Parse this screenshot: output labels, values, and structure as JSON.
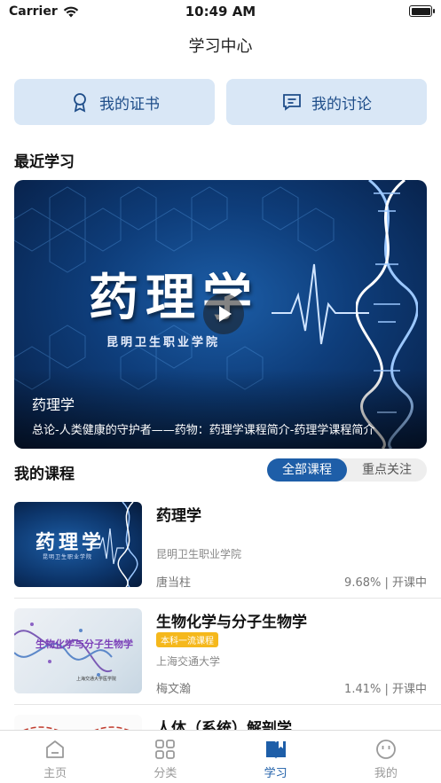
{
  "status": {
    "carrier": "Carrier",
    "time": "10:49 AM"
  },
  "nav": {
    "title": "学习中心"
  },
  "actions": {
    "certificate": "我的证书",
    "discussion": "我的讨论"
  },
  "recent": {
    "section_title": "最近学习",
    "banner_title_art": "药理学",
    "banner_school_art": "昆明卫生职业学院",
    "title": "药理学",
    "description": "总论-人类健康的守护者——药物：药理学课程简介-药理学课程简介"
  },
  "my_courses": {
    "section_title": "我的课程",
    "tabs": [
      "全部课程",
      "重点关注"
    ],
    "active_tab": 0,
    "items": [
      {
        "title": "药理学",
        "tag": "",
        "school": "昆明卫生职业学院",
        "teacher": "唐当柱",
        "progress": "9.68% | 开课中",
        "thumb_text": "药理学",
        "thumb_sub": "昆明卫生职业学院"
      },
      {
        "title": "生物化学与分子生物学",
        "tag": "本科一流课程",
        "school": "上海交通大学",
        "teacher": "梅文瀚",
        "progress": "1.41% | 开课中",
        "thumb_text": "生物化学与分子生物学",
        "thumb_sub": "上海交通大学医学院"
      },
      {
        "title": "人体（系统）解剖学",
        "tag": "",
        "school": "",
        "teacher": "",
        "progress": ""
      }
    ]
  },
  "tabbar": {
    "items": [
      "主页",
      "分类",
      "学习",
      "我的"
    ],
    "active": 2,
    "accent": "#1e5ea8"
  }
}
